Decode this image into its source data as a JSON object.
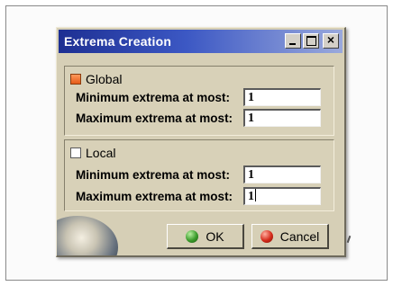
{
  "window": {
    "title": "Extrema Creation"
  },
  "global_group": {
    "label": "Global",
    "checked": true,
    "min_label": "Minimum extrema at most:",
    "min_value": "1",
    "max_label": "Maximum extrema at most:",
    "max_value": "1"
  },
  "local_group": {
    "label": "Local",
    "checked": false,
    "min_label": "Minimum extrema at most:",
    "min_value": "1",
    "max_label": "Maximum extrema at most:",
    "max_value": "1"
  },
  "buttons": {
    "ok_label": "OK",
    "cancel_label": "Cancel"
  },
  "icons": {
    "ok": "green-dot-icon",
    "cancel": "red-dot-icon"
  }
}
